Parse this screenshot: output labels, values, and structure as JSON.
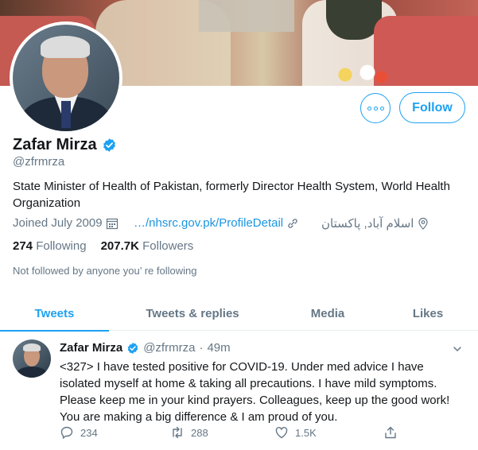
{
  "profile": {
    "name": "Zafar Mirza",
    "handle": "@zfrmrza",
    "bio": "State Minister of Health of Pakistan, formerly Director Health System, World Health Organization",
    "joined": "Joined July 2009",
    "website": "…/nhsrc.gov.pk/ProfileDetail",
    "location": "اسلام آباد, پاکستان",
    "following_count": "274",
    "following_label": "Following",
    "followers_count": "207.7K",
    "followers_label": "Followers",
    "not_followed": "Not followed by anyone you’ re following"
  },
  "buttons": {
    "follow_label": "Follow"
  },
  "tabs": [
    {
      "label": "Tweets",
      "active": true
    },
    {
      "label": "Tweets & replies",
      "active": false
    },
    {
      "label": "Media",
      "active": false
    },
    {
      "label": "Likes",
      "active": false
    }
  ],
  "tweet": {
    "name": "Zafar Mirza",
    "handle": "@zfrmrza",
    "separator": "·",
    "time": "49m",
    "text": "<327> I have tested positive for COVID-19. Under med advice I have isolated myself at home & taking all precautions. I have mild symptoms. Please keep me in your kind prayers. Colleagues, keep up the good work! You are making a big difference & I am proud of you.",
    "replies": "234",
    "retweets": "288",
    "likes": "1.5K"
  },
  "colors": {
    "accent": "#1da1f2",
    "muted": "#657786",
    "text": "#14171a"
  },
  "icons": [
    "more-icon",
    "verified-icon",
    "calendar-icon",
    "link-icon",
    "location-icon",
    "chevron-down-icon",
    "reply-icon",
    "retweet-icon",
    "like-icon",
    "share-icon"
  ]
}
